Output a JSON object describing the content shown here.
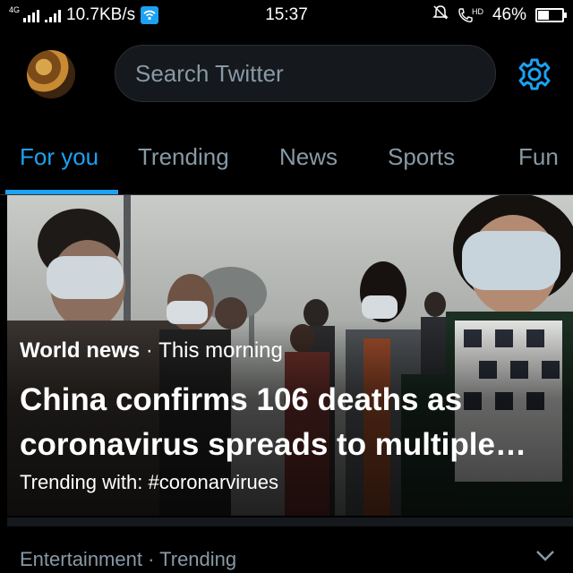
{
  "status_bar": {
    "network_type": "4G",
    "speed": "10.7KB/s",
    "time": "15:37",
    "hd_label": "HD",
    "battery_percent": "46%",
    "battery_level": 0.46
  },
  "header": {
    "search_placeholder": "Search Twitter"
  },
  "tabs": [
    {
      "label": "For you",
      "active": true
    },
    {
      "label": "Trending",
      "active": false
    },
    {
      "label": "News",
      "active": false
    },
    {
      "label": "Sports",
      "active": false
    },
    {
      "label": "Fun",
      "active": false
    }
  ],
  "hero": {
    "category": "World news",
    "separator": " · ",
    "time": "This morning",
    "title": "China confirms 106 deaths as coronavirus spreads to multiple…",
    "trending": "Trending with: #coronarvirues"
  },
  "next_item": {
    "category": "Entertainment",
    "separator": " · ",
    "label": "Trending"
  },
  "colors": {
    "accent": "#1da1f2",
    "secondary_text": "#8899a6",
    "background": "#000000"
  },
  "icons": [
    "signal-icon",
    "wifi-icon",
    "mute-icon",
    "call-icon",
    "battery-icon",
    "settings-gear-icon",
    "chevron-down-icon"
  ]
}
